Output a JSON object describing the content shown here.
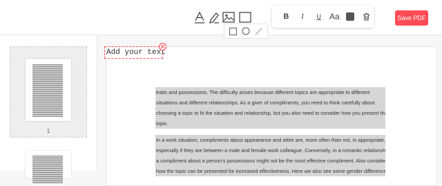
{
  "toolbar": {
    "tools": [
      {
        "name": "text-tool-icon"
      },
      {
        "name": "pen-tool-icon"
      },
      {
        "name": "image-tool-icon"
      },
      {
        "name": "shape-tool-icon"
      }
    ],
    "format": {
      "bold": "B",
      "italic": "I",
      "underline": "U",
      "font_size": "Aa",
      "color": "#555555",
      "delete_icon": "trash-icon"
    },
    "save_label": "Save PDF",
    "save_color": "#ff4b55"
  },
  "shape_menu": {
    "options": [
      "square-shape-icon",
      "circle-shape-icon",
      "line-shape-icon"
    ]
  },
  "sidebar": {
    "close_icon": "close-icon",
    "pages": [
      {
        "number": "1"
      }
    ]
  },
  "editor": {
    "text_box": "Add your text",
    "paragraph1": [
      "traits and possessions. The difficulty arises because different topics are appropriate to different",
      "situations and different relationships. As a giver of compliments, you need to think carefully about",
      "choosing a topic to fit the situation and relationship, but you also need to consider how you present that",
      "topic."
    ],
    "paragraph2": [
      "In a work situation, compliments about appearance and attire are, more often than not, in appropriate,",
      "especially if they are between a male and female work colleague. Conversely, in a romantic relationship,",
      "a compliment about a person's possessions might not be the most effective compliment. Also consider",
      "how the topic can be presented for increased effectiveness. Here we also see some gender differences."
    ]
  }
}
